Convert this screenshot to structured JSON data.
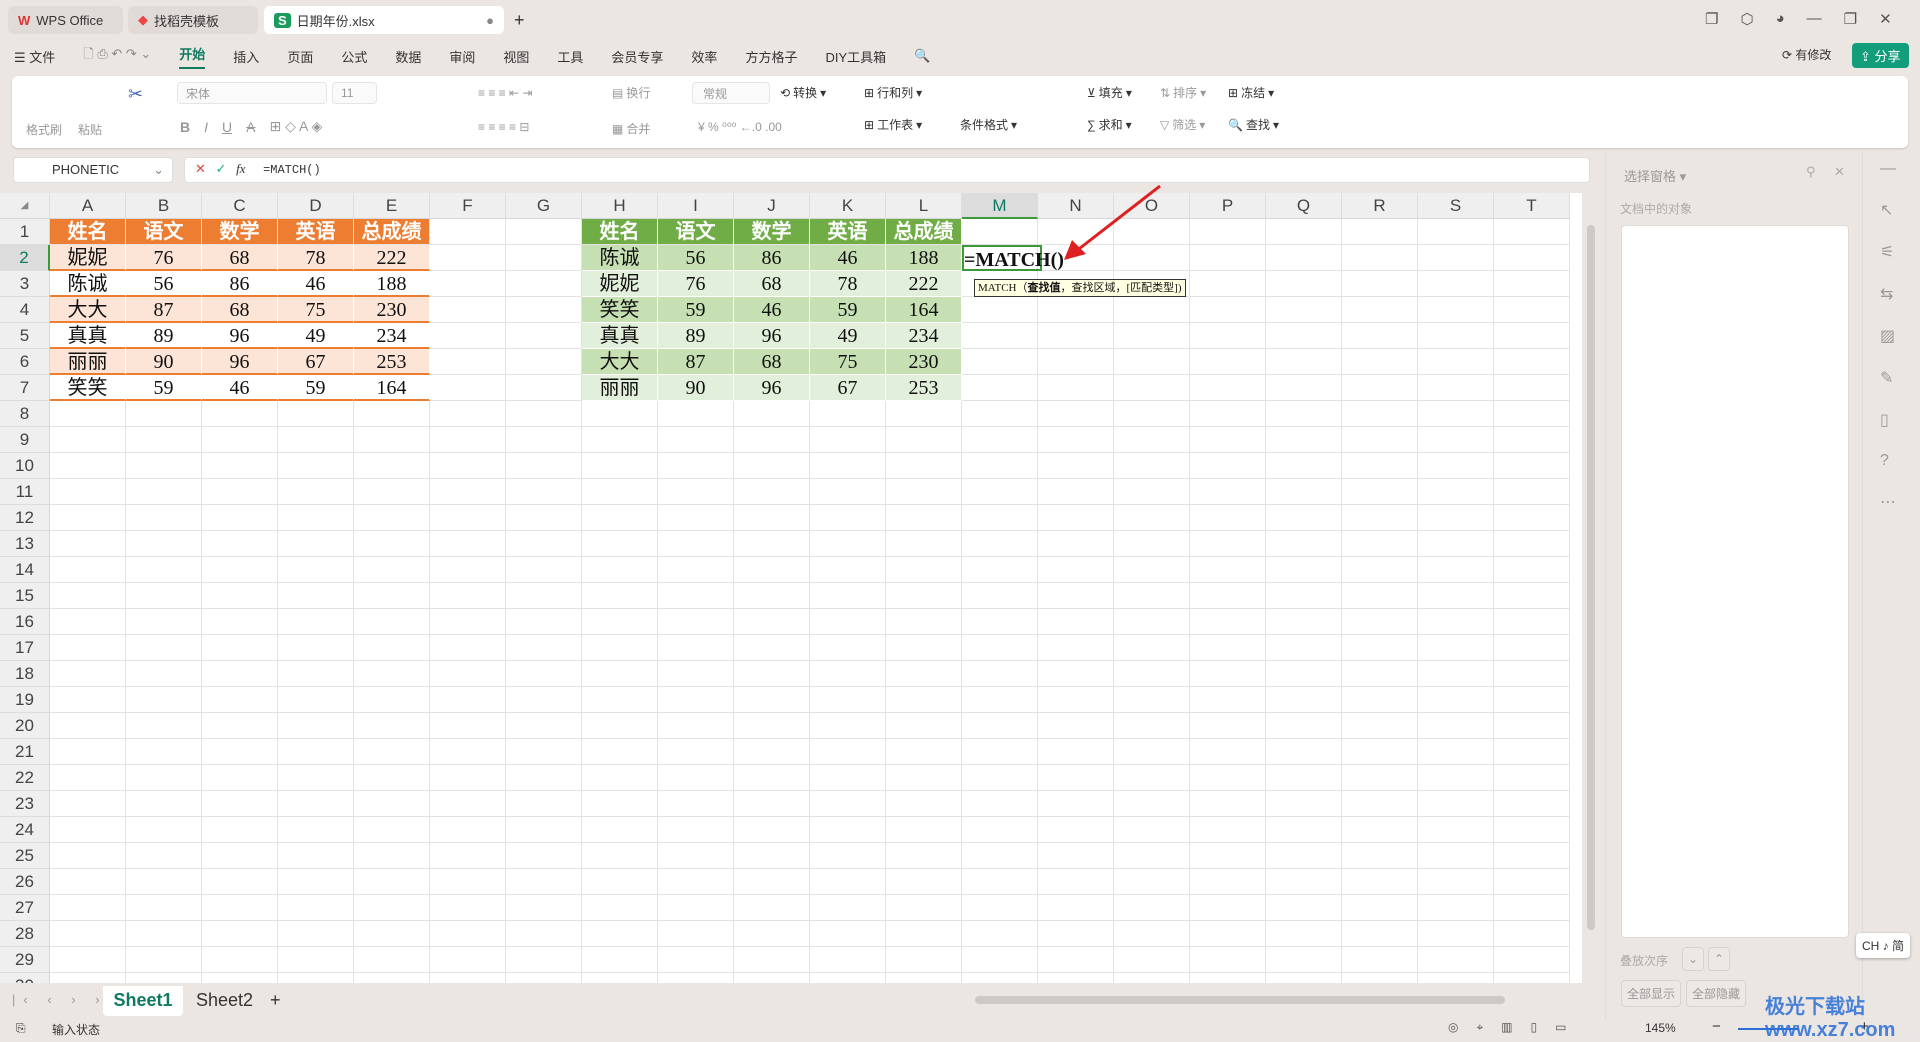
{
  "titlebar": {
    "tabs": [
      {
        "label": "WPS Office"
      },
      {
        "label": "找稻壳模板"
      },
      {
        "label": "日期年份.xlsx"
      }
    ],
    "new_tab": "+"
  },
  "menu": {
    "file": "文件",
    "items": [
      "开始",
      "插入",
      "页面",
      "公式",
      "数据",
      "审阅",
      "视图",
      "工具",
      "会员专享",
      "效率",
      "方方格子",
      "DIY工具箱"
    ],
    "active": "开始",
    "changes": "有修改",
    "share": "分享"
  },
  "ribbon": {
    "format_painter": "格式刷",
    "paste": "粘贴",
    "font": "宋体",
    "font_size": "11",
    "wrap": "换行",
    "merge": "合并",
    "number_format": "常规",
    "convert": "转换",
    "rows_cols": "行和列",
    "worksheet": "工作表",
    "cond_format": "条件格式",
    "fill": "填充",
    "sort": "排序",
    "freeze": "冻结",
    "sum": "求和",
    "filter": "筛选",
    "find": "查找"
  },
  "formula_bar": {
    "name_box": "PHONETIC",
    "formula": "=MATCH()"
  },
  "columns": [
    "A",
    "B",
    "C",
    "D",
    "E",
    "F",
    "G",
    "H",
    "I",
    "J",
    "K",
    "L",
    "M",
    "N",
    "O",
    "P",
    "Q",
    "R",
    "S",
    "T"
  ],
  "row_count": 30,
  "table1": {
    "header": [
      "姓名",
      "语文",
      "数学",
      "英语",
      "总成绩"
    ],
    "rows": [
      [
        "妮妮",
        "76",
        "68",
        "78",
        "222"
      ],
      [
        "陈诚",
        "56",
        "86",
        "46",
        "188"
      ],
      [
        "大大",
        "87",
        "68",
        "75",
        "230"
      ],
      [
        "真真",
        "89",
        "96",
        "49",
        "234"
      ],
      [
        "丽丽",
        "90",
        "96",
        "67",
        "253"
      ],
      [
        "笑笑",
        "59",
        "46",
        "59",
        "164"
      ]
    ]
  },
  "table2": {
    "header": [
      "姓名",
      "语文",
      "数学",
      "英语",
      "总成绩"
    ],
    "rows": [
      [
        "陈诚",
        "56",
        "86",
        "46",
        "188"
      ],
      [
        "妮妮",
        "76",
        "68",
        "78",
        "222"
      ],
      [
        "笑笑",
        "59",
        "46",
        "59",
        "164"
      ],
      [
        "真真",
        "89",
        "96",
        "49",
        "234"
      ],
      [
        "大大",
        "87",
        "68",
        "75",
        "230"
      ],
      [
        "丽丽",
        "90",
        "96",
        "67",
        "253"
      ]
    ]
  },
  "active_cell": {
    "ref": "M2",
    "text": "=MATCH()",
    "tooltip_fn": "MATCH（",
    "tooltip_arg1": "查找值",
    "tooltip_rest": "，查找区域，[匹配类型])"
  },
  "colors": {
    "orange_header": "#ED7D31",
    "orange_band": "#FCE4D6",
    "green_header": "#70AD47",
    "green_dark": "#C6E0B4",
    "green_light": "#E2EFDA",
    "accent": "#0e7a5f",
    "arrow": "#e02020"
  },
  "sheets": {
    "tabs": [
      "Sheet1",
      "Sheet2"
    ],
    "active": "Sheet1",
    "add": "+"
  },
  "side_panel": {
    "title": "选择窗格",
    "objects_label": "文档中的对象",
    "order_label": "叠放次序",
    "show_all": "全部显示",
    "hide_all": "全部隐藏"
  },
  "ime": "CH ♪ 简",
  "status": {
    "mode": "输入状态",
    "zoom": "145%"
  },
  "watermark": "极光下载站 www.xz7.com"
}
